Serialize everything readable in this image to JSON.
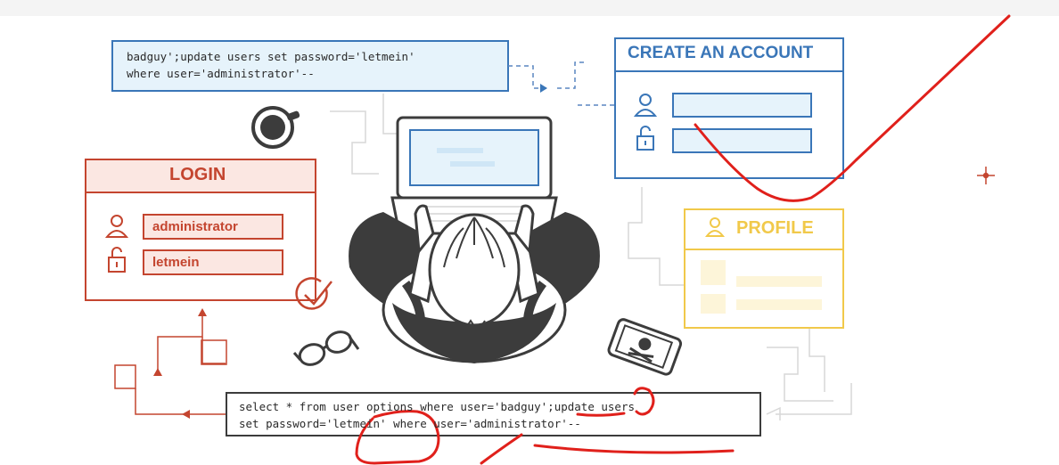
{
  "injection_box": {
    "line1": "badguy';update users set password='letmein'",
    "line2": "where user='administrator'--"
  },
  "create_account": {
    "title": "CREATE AN ACCOUNT"
  },
  "login": {
    "title": "LOGIN",
    "username_value": "administrator",
    "password_value": "letmein"
  },
  "profile": {
    "title": "PROFILE"
  },
  "query_box": {
    "line1": "select * from user options where user='badguy';update users",
    "line2": "set password='letmein' where user='administrator'--"
  },
  "colors": {
    "blue": "#3a76b8",
    "blue_fill": "#e6f3fb",
    "red": "#c4452f",
    "red_fill": "#fbe7e2",
    "yellow": "#f1c94a",
    "dark": "#3c3c3c",
    "annotation_red": "#e0201b"
  }
}
